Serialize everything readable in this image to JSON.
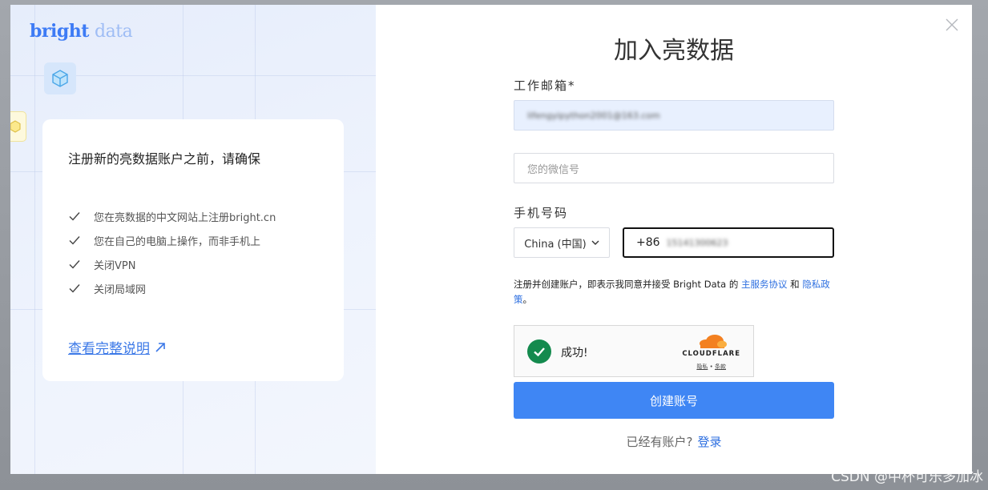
{
  "left_panel": {
    "logo_main": "bright",
    "logo_secondary": "data",
    "card_title": "注册新的亮数据账户之前，请确保",
    "requirements": [
      "您在亮数据的中文网站上注册bright.cn",
      "您在自己的电脑上操作，而非手机上",
      "关闭VPN",
      "关闭局域网"
    ],
    "guide_link": "查看完整说明"
  },
  "form": {
    "title": "加入亮数据",
    "email_label": "工作邮箱*",
    "email_value": "lifengyipython2001@163.com",
    "wechat_placeholder": "您的微信号",
    "phone_label": "手机号码",
    "country_value": "China (中国)",
    "phone_prefix": "+86",
    "phone_value": "15141300623",
    "terms_prefix": "注册并创建账户，即表示我同意并接受 Bright Data 的 ",
    "terms_link1": "主服务协议",
    "terms_and": " 和 ",
    "terms_link2": "隐私政策",
    "terms_end": "。",
    "captcha_status": "成功!",
    "captcha_brand": "CLOUDFLARE",
    "captcha_privacy": "隐私",
    "captcha_sep": "•",
    "captcha_terms": "条款",
    "submit_label": "创建账号",
    "have_account": "已经有账户?",
    "login_link": "登录"
  },
  "watermark": "CSDN @中杯可乐多加冰",
  "colors": {
    "accent": "#3f86f4",
    "link": "#2d6fe0",
    "success": "#148a4e",
    "cloudflare_orange": "#f38020"
  }
}
